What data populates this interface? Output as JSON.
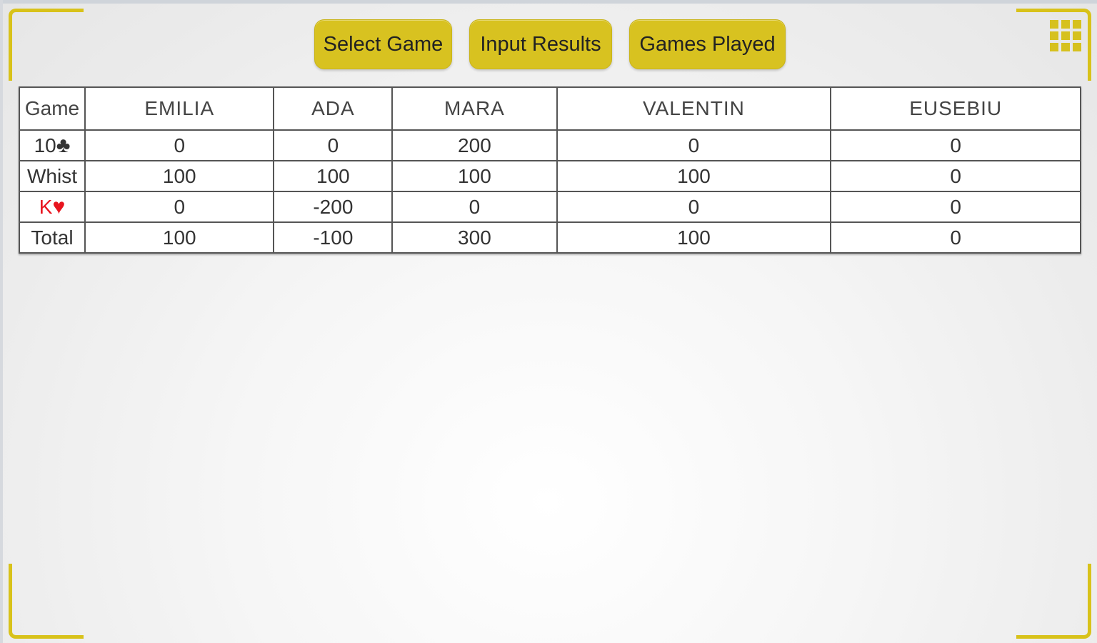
{
  "toolbar": {
    "buttons": [
      {
        "label": "Select Game"
      },
      {
        "label": "Input Results"
      },
      {
        "label": "Games Played"
      }
    ],
    "menu_icon": "grid-menu-icon"
  },
  "colors": {
    "accent": "#d8c220",
    "red_suit": "#e8141e"
  },
  "scoreboard": {
    "columns": [
      "Game",
      "EMILIA",
      "ADA",
      "MARA",
      "VALENTIN",
      "EUSEBIU"
    ],
    "rows": [
      {
        "game_value": "10",
        "game_suit": "♣",
        "values": [
          "0",
          "0",
          "200",
          "0",
          "0"
        ]
      },
      {
        "game_value": "Whist",
        "game_suit": "",
        "values": [
          "100",
          "100",
          "100",
          "100",
          "0"
        ]
      },
      {
        "game_value": "K",
        "game_suit": "♥",
        "values": [
          "0",
          "-200",
          "0",
          "0",
          "0"
        ]
      },
      {
        "game_value": "Total",
        "game_suit": "",
        "values": [
          "100",
          "-100",
          "300",
          "100",
          "0"
        ]
      }
    ]
  }
}
